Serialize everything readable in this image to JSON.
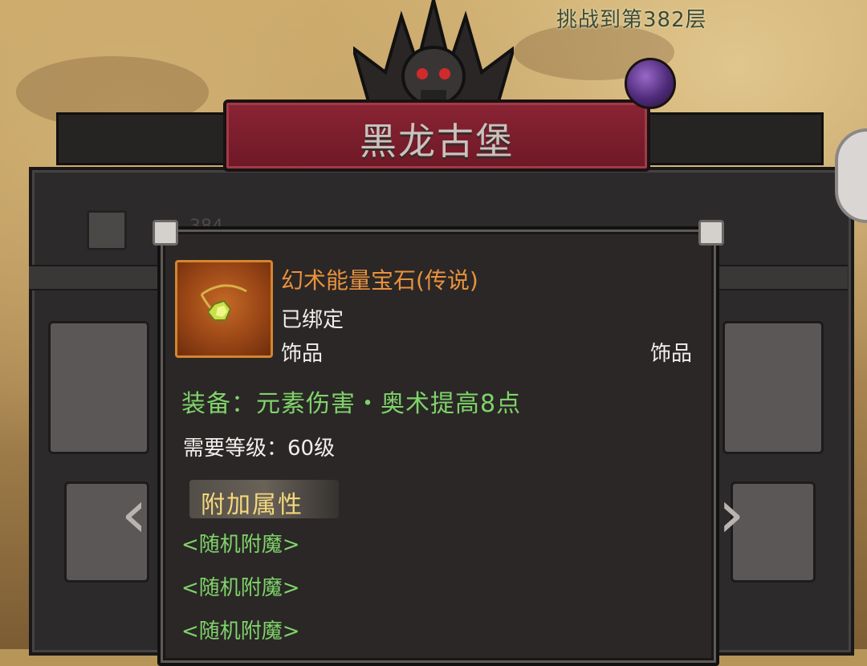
{
  "header": {
    "challenge": "挑战到第382层",
    "title": "黑龙古堡"
  },
  "background": {
    "level_hint": "384"
  },
  "tooltip": {
    "item_name": "幻术能量宝石(传说)",
    "bound": "已绑定",
    "slot_type": "饰品",
    "slot_category": "饰品",
    "equip_effect": "装备：元素伤害・奥术提高8点",
    "required_level": "需要等级：60级",
    "extra_attr_header": "附加属性",
    "enchants": [
      "<随机附魔>",
      "<随机附魔>",
      "<随机附魔>"
    ],
    "rarity_color": "#e8913d",
    "effect_color": "#7fd36a"
  },
  "icons": {
    "item": "gem-necklace-icon",
    "left_arrow": "chevron-left-icon",
    "right_arrow": "chevron-right-icon"
  }
}
